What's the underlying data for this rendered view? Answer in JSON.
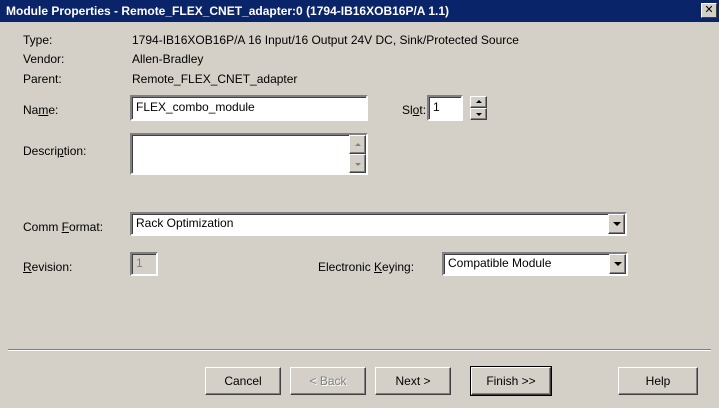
{
  "window": {
    "title": "Module Properties  - Remote_FLEX_CNET_adapter:0 (1794-IB16XOB16P/A 1.1)",
    "close_glyph": "✕"
  },
  "info": {
    "type_label": "Type:",
    "type_value": "1794-IB16XOB16P/A 16 Input/16 Output 24V DC, Sink/Protected Source",
    "vendor_label": "Vendor:",
    "vendor_value": "Allen-Bradley",
    "parent_label": "Parent:",
    "parent_value": "Remote_FLEX_CNET_adapter"
  },
  "form": {
    "name_label_pre": "Na",
    "name_label_key": "m",
    "name_label_post": "e:",
    "name_value": "FLEX_combo_module",
    "slot_label_pre": "Sl",
    "slot_label_key": "o",
    "slot_label_post": "t:",
    "slot_value": "1",
    "description_label_pre": "Descri",
    "description_label_key": "p",
    "description_label_post": "tion:",
    "description_value": "",
    "comm_format_label_pre": "Comm ",
    "comm_format_label_key": "F",
    "comm_format_label_post": "ormat:",
    "comm_format_value": "Rack Optimization",
    "revision_label_pre": "",
    "revision_label_key": "R",
    "revision_label_post": "evision:",
    "revision_value": "1",
    "keying_label_pre": "Electronic ",
    "keying_label_key": "K",
    "keying_label_post": "eying:",
    "keying_value": "Compatible Module"
  },
  "buttons": {
    "cancel": "Cancel",
    "back": "< Back",
    "next": "Next >",
    "finish": "Finish >>",
    "help": "Help"
  },
  "colors": {
    "titlebar": "#0a246a",
    "face": "#d4d0c8"
  }
}
